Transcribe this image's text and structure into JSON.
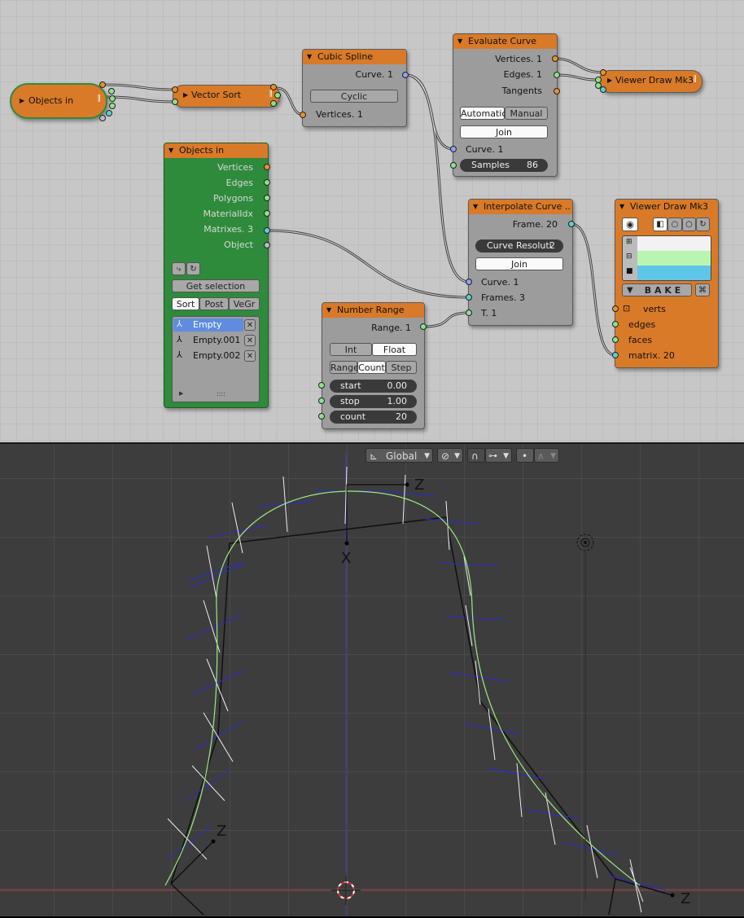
{
  "node_editor": {
    "nodes": {
      "objects_in_collapsed": {
        "title": "Objects in"
      },
      "vector_sort": {
        "title": "Vector Sort"
      },
      "cubic_spline": {
        "title": "Cubic Spline",
        "out_curve": "Curve. 1",
        "cyclic_label": "Cyclic",
        "in_vertices": "Vertices. 1"
      },
      "evaluate_curve": {
        "title": "Evaluate Curve",
        "out_vertices": "Vertices. 1",
        "out_edges": "Edges. 1",
        "out_tangents": "Tangents",
        "mode_automatic": "Automatic",
        "mode_manual": "Manual",
        "join_label": "Join",
        "in_curve": "Curve. 1",
        "samples_label": "Samples",
        "samples_value": "86"
      },
      "viewer_draw_top": {
        "title": "Viewer Draw Mk3"
      },
      "objects_in": {
        "title": "Objects in",
        "outputs": [
          "Vertices",
          "Edges",
          "Polygons",
          "MaterialIdx",
          "Matrixes. 3",
          "Object"
        ],
        "get_selection_label": "Get selection",
        "tabs": [
          "Sort",
          "Post",
          "VeGr"
        ],
        "items": [
          "Empty",
          "Empty.001",
          "Empty.002"
        ],
        "list_footer": "::::"
      },
      "interpolate_curve": {
        "title": "Interpolate Curve ..",
        "out_frame": "Frame. 20",
        "resolution_label": "Curve Resoluti",
        "resolution_value": "2",
        "join_label": "Join",
        "in_curve": "Curve. 1",
        "in_frames": "Frames. 3",
        "in_t": "T. 1"
      },
      "number_range": {
        "title": "Number Range",
        "out_range": "Range. 1",
        "type_int": "Int",
        "type_float": "Float",
        "mode_range": "Range",
        "mode_count": "Count",
        "mode_step": "Step",
        "start_label": "start",
        "start_value": "0.00",
        "stop_label": "stop",
        "stop_value": "1.00",
        "count_label": "count",
        "count_value": "20"
      },
      "viewer_draw": {
        "title": "Viewer Draw Mk3",
        "bake_label": "B A K E",
        "inputs": [
          "verts",
          "edges",
          "faces",
          "matrix. 20"
        ],
        "colors": [
          "#f2f2f2",
          "#b8f5b0",
          "#5ec6e8"
        ]
      }
    }
  },
  "viewport": {
    "header": {
      "orientation_label": "Global"
    },
    "axis_labels": [
      "Z",
      "X",
      "Z",
      "Z"
    ],
    "colors": {
      "curve": "#9bea7e",
      "x_axis": "#c03030",
      "z_axis": "#3030c0"
    }
  }
}
